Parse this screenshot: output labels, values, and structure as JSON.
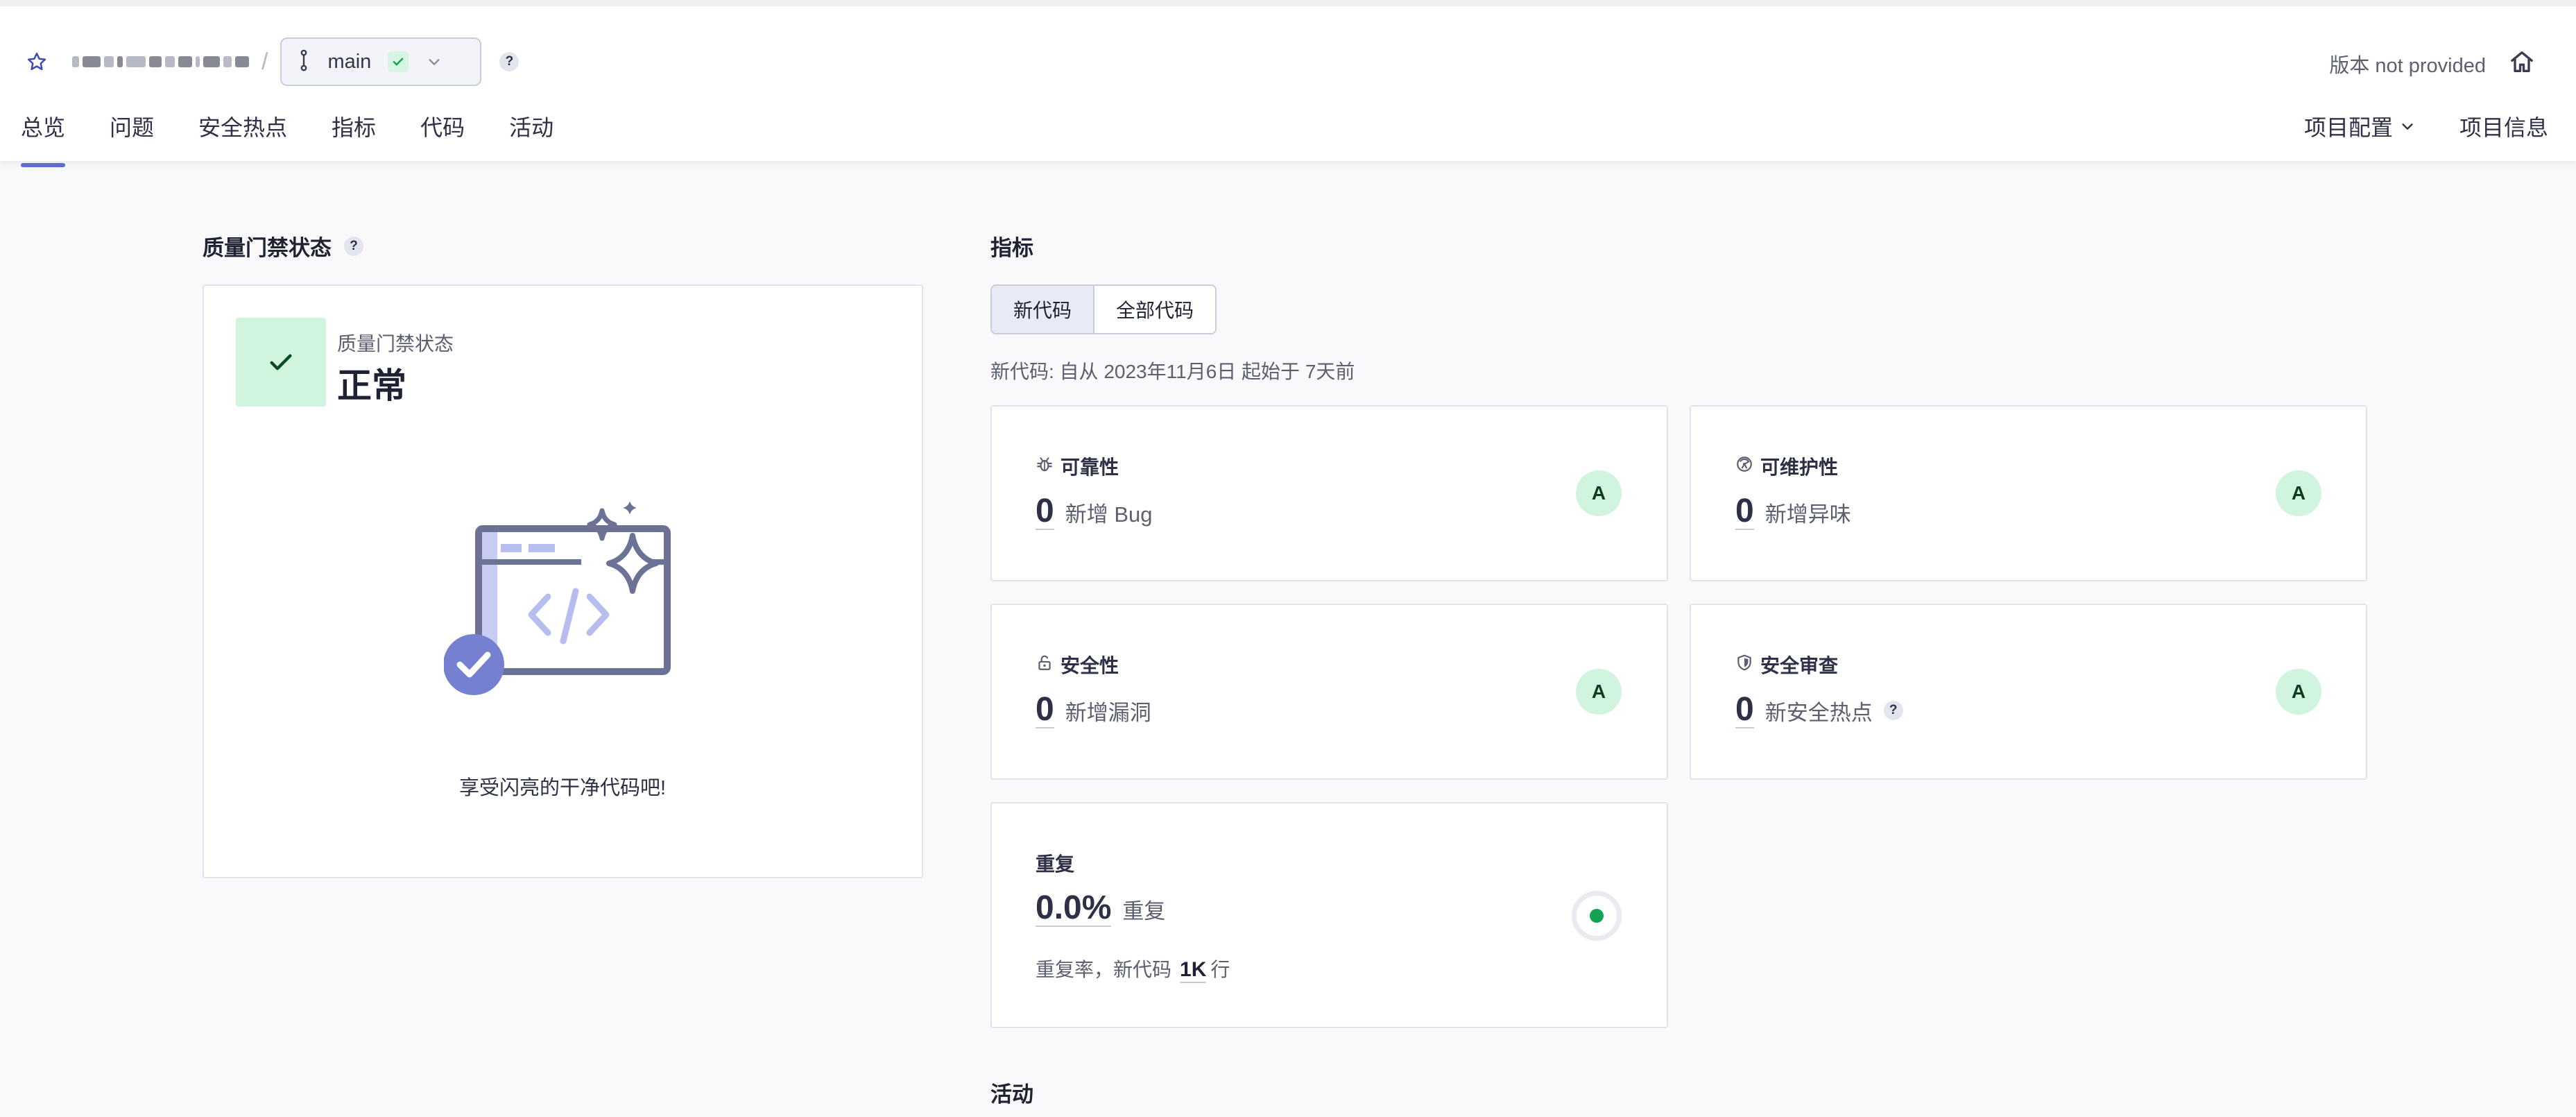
{
  "header": {
    "project_name": "",
    "separator": "/",
    "branch": "main",
    "branch_help": "?",
    "version_text": "版本 not provided"
  },
  "nav": {
    "tabs": [
      {
        "label": "总览",
        "active": true
      },
      {
        "label": "问题"
      },
      {
        "label": "安全热点"
      },
      {
        "label": "指标"
      },
      {
        "label": "代码"
      },
      {
        "label": "活动"
      }
    ],
    "project_config": "项目配置",
    "project_info": "项目信息"
  },
  "quality_gate": {
    "title": "质量门禁状态",
    "title_help": "?",
    "label": "质量门禁状态",
    "status": "正常",
    "message": "享受闪亮的干净代码吧!"
  },
  "metrics": {
    "title": "指标",
    "toggle": {
      "new_code": "新代码",
      "all_code": "全部代码"
    },
    "period": "新代码: 自从 2023年11月6日  起始于 7天前",
    "reliability": {
      "title": "可靠性",
      "value": "0",
      "unit": "新增 Bug",
      "rating": "A"
    },
    "maintainability": {
      "title": "可维护性",
      "value": "0",
      "unit": "新增异味",
      "rating": "A"
    },
    "security": {
      "title": "安全性",
      "value": "0",
      "unit": "新增漏洞",
      "rating": "A"
    },
    "security_review": {
      "title": "安全审查",
      "value": "0",
      "unit": "新安全热点",
      "help": "?",
      "rating": "A"
    },
    "duplication": {
      "title": "重复",
      "value": "0.0%",
      "unit": "重复",
      "sub_prefix": "重复率，新代码",
      "sub_lines": "1K",
      "sub_suffix": "行"
    }
  },
  "activity": {
    "title": "活动"
  },
  "colors": {
    "accent": "#5d6cd0",
    "success_bg": "#d1f4de",
    "success": "#12a551"
  }
}
